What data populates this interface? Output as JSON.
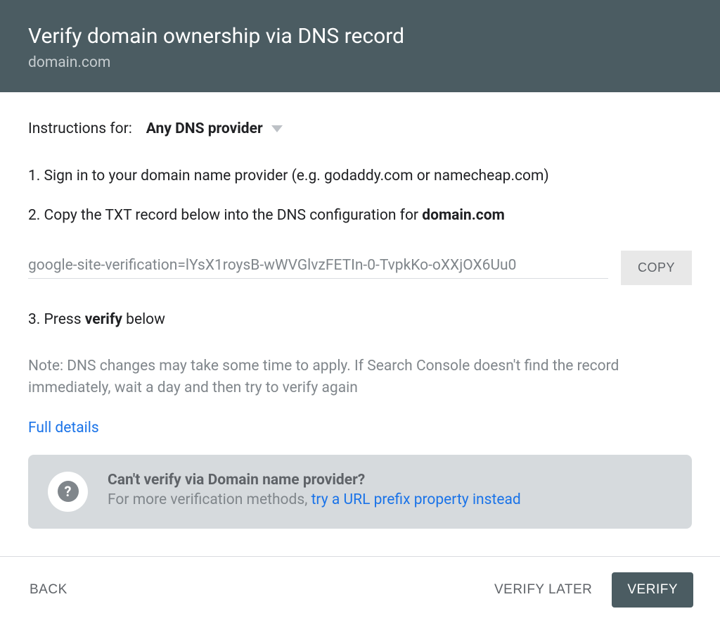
{
  "header": {
    "title": "Verify domain ownership via DNS record",
    "subtitle": "domain.com"
  },
  "instructions": {
    "label": "Instructions for:",
    "provider": "Any DNS provider"
  },
  "steps": {
    "step1": "1. Sign in to your domain name provider (e.g. godaddy.com or namecheap.com)",
    "step2_prefix": "2. Copy the TXT record below into the DNS configuration for ",
    "step2_domain": "domain.com",
    "step3_prefix": "3. Press ",
    "step3_bold": "verify",
    "step3_suffix": " below"
  },
  "txt_record": {
    "value": "google-site-verification=lYsX1roysB-wWVGlvzFETIn-0-TvpkKo-oXXjOX6Uu0",
    "copy_label": "COPY"
  },
  "note": "Note: DNS changes may take some time to apply. If Search Console doesn't find the record immediately, wait a day and then try to verify again",
  "full_details": "Full details",
  "info_box": {
    "title": "Can't verify via Domain name provider?",
    "desc_prefix": "For more verification methods, ",
    "link_text": "try a URL prefix property instead"
  },
  "footer": {
    "back": "BACK",
    "verify_later": "VERIFY LATER",
    "verify": "VERIFY"
  }
}
